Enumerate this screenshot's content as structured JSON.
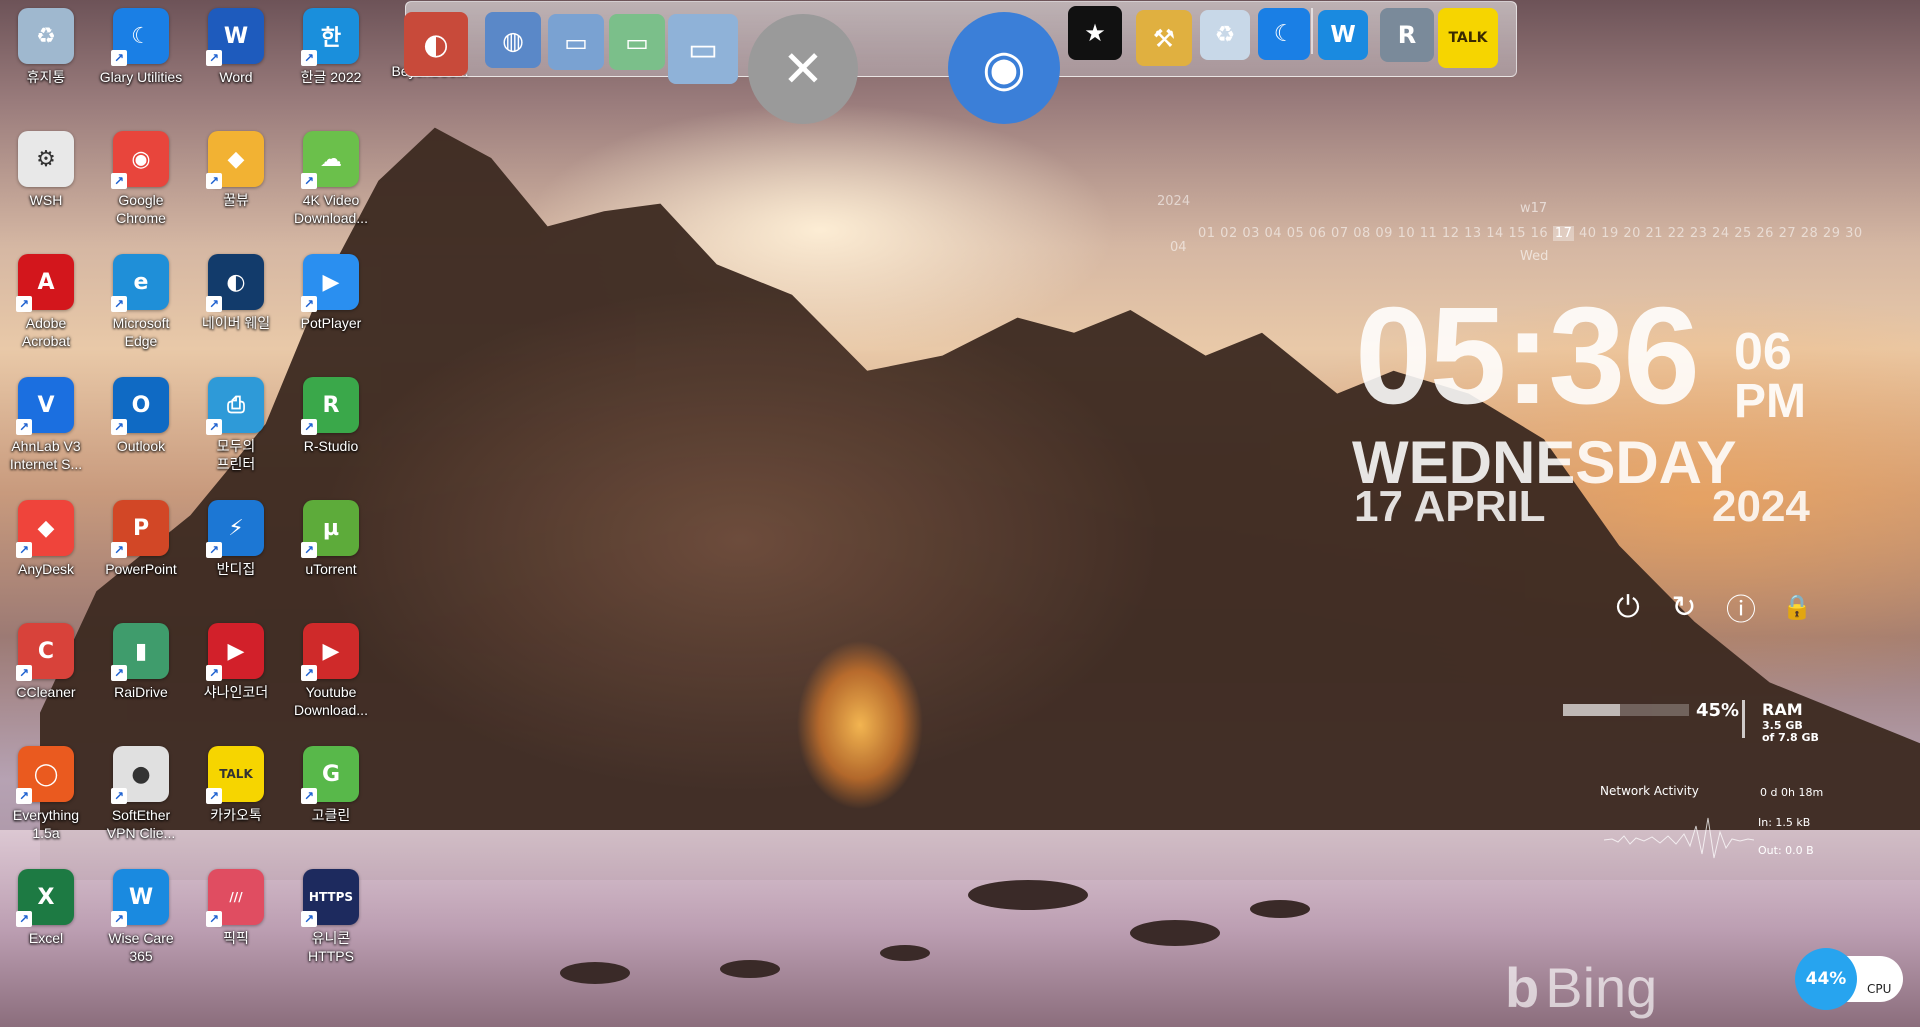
{
  "desktop_icons": [
    {
      "label": "휴지통",
      "color": "#9fb8cf",
      "glyph": "♻",
      "x": 0,
      "y": 0,
      "shortcut": false
    },
    {
      "label": "Glary Utilities",
      "color": "#1a7fe5",
      "glyph": "☾",
      "x": 1,
      "y": 0,
      "shortcut": true
    },
    {
      "label": "Word",
      "color": "#1e5bbd",
      "glyph": "W",
      "x": 2,
      "y": 0,
      "shortcut": true
    },
    {
      "label": "한글 2022",
      "color": "#1a8fdc",
      "glyph": "한",
      "x": 3,
      "y": 0,
      "shortcut": true
    },
    {
      "label": "WSH",
      "color": "#e8e8e8",
      "glyph": "⚙",
      "x": 0,
      "y": 1,
      "shortcut": false
    },
    {
      "label": "Google\nChrome",
      "color": "#e8453c",
      "glyph": "◉",
      "x": 1,
      "y": 1,
      "shortcut": true
    },
    {
      "label": "꿀뷰",
      "color": "#f2b233",
      "glyph": "◆",
      "x": 2,
      "y": 1,
      "shortcut": true
    },
    {
      "label": "4K Video\nDownload...",
      "color": "#6bc04b",
      "glyph": "☁",
      "x": 3,
      "y": 1,
      "shortcut": true
    },
    {
      "label": "Adobe\nAcrobat",
      "color": "#d3161c",
      "glyph": "A",
      "x": 0,
      "y": 2,
      "shortcut": true
    },
    {
      "label": "Microsoft\nEdge",
      "color": "#1f8fd8",
      "glyph": "e",
      "x": 1,
      "y": 2,
      "shortcut": true
    },
    {
      "label": "네이버 웨일",
      "color": "#123b6b",
      "glyph": "◐",
      "x": 2,
      "y": 2,
      "shortcut": true
    },
    {
      "label": "PotPlayer",
      "color": "#2a8ff0",
      "glyph": "▶",
      "x": 3,
      "y": 2,
      "shortcut": true
    },
    {
      "label": "AhnLab V3\nInternet S...",
      "color": "#1b6fe0",
      "glyph": "V",
      "x": 0,
      "y": 3,
      "shortcut": true
    },
    {
      "label": "Outlook",
      "color": "#0f6ac4",
      "glyph": "O",
      "x": 1,
      "y": 3,
      "shortcut": true
    },
    {
      "label": "모두의\n프린터",
      "color": "#2e9ad8",
      "glyph": "⎙",
      "x": 2,
      "y": 3,
      "shortcut": true
    },
    {
      "label": "R-Studio",
      "color": "#3aa84a",
      "glyph": "R",
      "x": 3,
      "y": 3,
      "shortcut": true
    },
    {
      "label": "AnyDesk",
      "color": "#ef443b",
      "glyph": "◆",
      "x": 0,
      "y": 4,
      "shortcut": true
    },
    {
      "label": "PowerPoint",
      "color": "#d24726",
      "glyph": "P",
      "x": 1,
      "y": 4,
      "shortcut": true
    },
    {
      "label": "반디집",
      "color": "#1c77d4",
      "glyph": "⚡",
      "x": 2,
      "y": 4,
      "shortcut": true
    },
    {
      "label": "uTorrent",
      "color": "#5dab3a",
      "glyph": "µ",
      "x": 3,
      "y": 4,
      "shortcut": true
    },
    {
      "label": "CCleaner",
      "color": "#d8423a",
      "glyph": "C",
      "x": 0,
      "y": 5,
      "shortcut": true
    },
    {
      "label": "RaiDrive",
      "color": "#3f9c6c",
      "glyph": "▮",
      "x": 1,
      "y": 5,
      "shortcut": true
    },
    {
      "label": "샤나인코더",
      "color": "#d2202a",
      "glyph": "▶",
      "x": 2,
      "y": 5,
      "shortcut": true
    },
    {
      "label": "Youtube\nDownload...",
      "color": "#cf2a2a",
      "glyph": "▶",
      "x": 3,
      "y": 5,
      "shortcut": true
    },
    {
      "label": "Everything\n1.5a",
      "color": "#ea5a1f",
      "glyph": "◯",
      "x": 0,
      "y": 6,
      "shortcut": true
    },
    {
      "label": "SoftEther\nVPN Clie...",
      "color": "#e0e0e0",
      "glyph": "●",
      "x": 1,
      "y": 6,
      "shortcut": true
    },
    {
      "label": "카카오톡",
      "color": "#f6d500",
      "glyph": "TALK",
      "x": 2,
      "y": 6,
      "shortcut": true
    },
    {
      "label": "고클린",
      "color": "#58b84a",
      "glyph": "G",
      "x": 3,
      "y": 6,
      "shortcut": true
    },
    {
      "label": "Excel",
      "color": "#1d7a43",
      "glyph": "X",
      "x": 0,
      "y": 7,
      "shortcut": true
    },
    {
      "label": "Wise Care\n365",
      "color": "#1a8ae0",
      "glyph": "W",
      "x": 1,
      "y": 7,
      "shortcut": true
    },
    {
      "label": "픽픽",
      "color": "#e04d61",
      "glyph": "///",
      "x": 2,
      "y": 7,
      "shortcut": true
    },
    {
      "label": "유니콘\nHTTPS",
      "color": "#1d2a5e",
      "glyph": "HTTPS",
      "x": 3,
      "y": 7,
      "shortcut": true
    }
  ],
  "extra_label": "BeyondCo...",
  "dock": {
    "items": [
      {
        "name": "dock-beyondcompare-icon",
        "color": "#c84a3a",
        "glyph": "◐"
      },
      {
        "name": "dock-network-icon",
        "color": "#5a88c8",
        "glyph": "◍"
      },
      {
        "name": "dock-folder-icon",
        "color": "#7aa2d2",
        "glyph": "▭"
      },
      {
        "name": "dock-folder-green-icon",
        "color": "#7bbf8a",
        "glyph": "▭"
      },
      {
        "name": "dock-folder-open-icon",
        "color": "#8fb2d8",
        "glyph": "▭"
      },
      {
        "name": "dock-tools-icon",
        "color": "#9a9a9a",
        "glyph": "✕"
      },
      {
        "name": "dock-globe-icon",
        "color": "#3b7fd8",
        "glyph": "◉"
      },
      {
        "name": "dock-tshirt-icon",
        "color": "#111111",
        "glyph": "★"
      },
      {
        "name": "dock-hammer-icon",
        "color": "#e0b040",
        "glyph": "⚒"
      },
      {
        "name": "dock-recycle-icon",
        "color": "#c8d8e8",
        "glyph": "♻"
      },
      {
        "name": "dock-glary-icon",
        "color": "#1a7fe5",
        "glyph": "☾"
      },
      {
        "name": "dock-wise-icon",
        "color": "#1a8ae0",
        "glyph": "W"
      },
      {
        "name": "dock-rstudio-icon",
        "color": "#7a8a9a",
        "glyph": "R"
      },
      {
        "name": "dock-kakaotalk-icon",
        "color": "#f6d500",
        "glyph": "TALK"
      }
    ]
  },
  "calendar": {
    "year": "2024",
    "month": "04",
    "week": "w17",
    "weekday": "Wed",
    "days_before": "01 02 03 04 05 06 07 08 09 10 11 12 13 14 15 16",
    "today": "17",
    "days_after": "40 19 20 21 22 23 24 25 26 27 28 29 30"
  },
  "clock": {
    "time": "05:36",
    "seconds": "06",
    "ampm": "PM",
    "day": "WEDNESDAY",
    "date": "17 APRIL",
    "year": "2024"
  },
  "power_buttons": [
    {
      "name": "shutdown-icon",
      "glyph": "⏻"
    },
    {
      "name": "restart-icon",
      "glyph": "↻"
    },
    {
      "name": "logoff-icon",
      "glyph": "ⓘ"
    },
    {
      "name": "lock-icon",
      "glyph": "🔒"
    }
  ],
  "ram": {
    "percent": "45%",
    "fill": 0.45,
    "label": "RAM",
    "used": "3.5 GB",
    "total": "of 7.8 GB"
  },
  "network": {
    "title": "Network Activity",
    "uptime": "0 d 0h 18m",
    "in": "In: 1.5 kB",
    "out": "Out: 0.0 B"
  },
  "bing": {
    "text": "Bing"
  },
  "cpu": {
    "percent": "44%",
    "label": "CPU"
  }
}
